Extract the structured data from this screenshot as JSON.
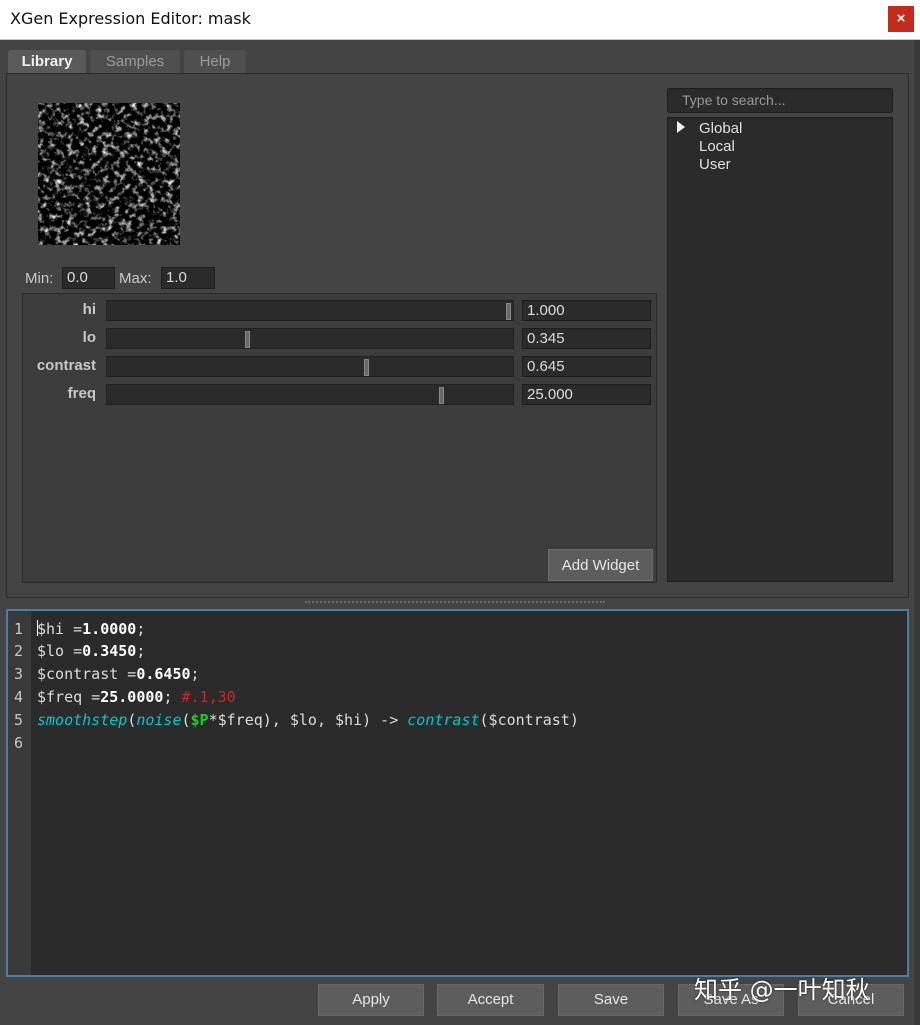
{
  "window": {
    "title": "XGen Expression Editor: mask",
    "close_glyph": "×"
  },
  "tabs": [
    {
      "label": "Library",
      "active": true
    },
    {
      "label": "Samples",
      "active": false
    },
    {
      "label": "Help",
      "active": false
    }
  ],
  "range": {
    "min_label": "Min:",
    "min_value": "0.0",
    "max_label": "Max:",
    "max_value": "1.0"
  },
  "widgets": [
    {
      "label": "hi",
      "value": "1.000",
      "fraction": 1.0
    },
    {
      "label": "lo",
      "value": "0.345",
      "fraction": 0.345
    },
    {
      "label": "contrast",
      "value": "0.645",
      "fraction": 0.645
    },
    {
      "label": "freq",
      "value": "25.000",
      "fraction": 0.833
    }
  ],
  "add_widget_label": "Add Widget",
  "search": {
    "placeholder": "Type to search..."
  },
  "tree": {
    "items": [
      "Global",
      "Local",
      "User"
    ]
  },
  "editor": {
    "line_numbers": [
      "1",
      "2",
      "3",
      "4",
      "5",
      "6"
    ],
    "lines": [
      "$hi =1.0000;",
      "$lo =0.3450;",
      "$contrast =0.6450;",
      "$freq =25.0000; #.1,30",
      "smoothstep(noise($P*$freq), $lo, $hi) -> contrast($contrast)",
      ""
    ]
  },
  "buttons": {
    "apply": "Apply",
    "accept": "Accept",
    "save": "Save",
    "save_as": "Save As",
    "cancel": "Cancel"
  },
  "watermark": "知乎 @一叶知秋",
  "colors": {
    "background": "#444444",
    "field": "#2b2b2b",
    "editor_border": "#4a7ea8",
    "function": "#00c8c8",
    "comment": "#c82828",
    "builtin": "#1fcf1f"
  }
}
